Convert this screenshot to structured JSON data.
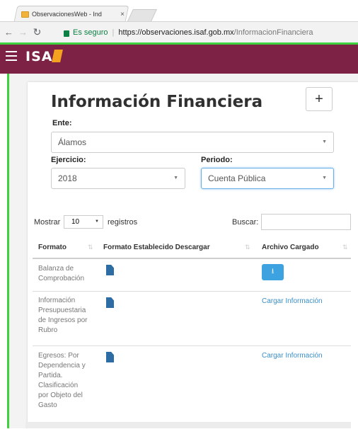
{
  "browser": {
    "tab_title": "ObservacionesWeb - Ind",
    "tab_close": "×",
    "secure_label": "Es seguro",
    "url_host": "https://observaciones.isaf.gob.mx",
    "url_path": "/InformacionFinanciera"
  },
  "app": {
    "logo_text": "ISA",
    "brand_color": "#7d2245"
  },
  "page": {
    "title": "Información Financiera",
    "add_label": "+",
    "ente_label": "Ente:",
    "ente_value": "Álamos",
    "ejercicio_label": "Ejercicio:",
    "ejercicio_value": "2018",
    "periodo_label": "Periodo:",
    "periodo_value": "Cuenta Pública"
  },
  "table": {
    "show_label": "Mostrar",
    "length_value": "10",
    "records_label": "registros",
    "search_label": "Buscar:",
    "headers": [
      "Formato",
      "Formato Establecido Descargar",
      "Archivo Cargado"
    ],
    "rows": [
      {
        "formato": [
          "Balanza de",
          "Comprobación"
        ],
        "archivo": ""
      },
      {
        "formato": [
          "Información",
          "Presupuestaria",
          "de Ingresos por",
          "Rubro"
        ],
        "archivo": "Cargar Información"
      },
      {
        "formato": [
          "Egresos: Por",
          "Dependencia y",
          "Partida.",
          "Clasificación",
          "por Objeto del",
          "Gasto"
        ],
        "archivo": "Cargar Información"
      }
    ]
  },
  "icons": {
    "menu": "hamburger-icon",
    "doc": "document-icon",
    "upload": "upload-icon"
  }
}
